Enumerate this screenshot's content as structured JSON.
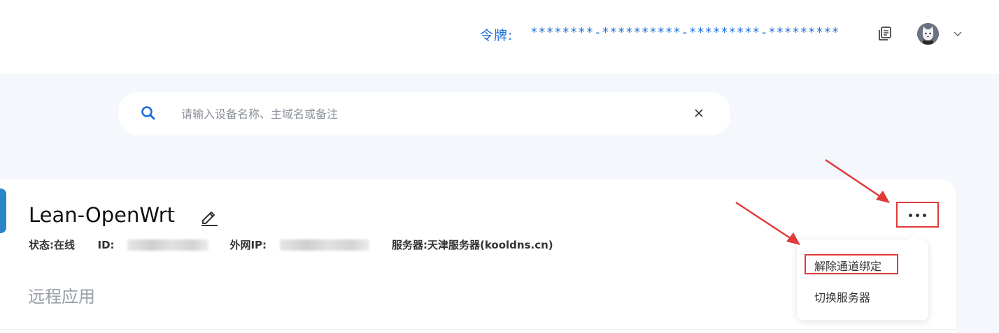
{
  "header": {
    "token_label": "令牌:",
    "token_value": "********-**********-*********-*********",
    "copy_icon": "copy-icon",
    "avatar_icon": "cat-avatar",
    "caret_icon": "chevron-down-icon"
  },
  "search": {
    "placeholder": "请输入设备名称、主域名或备注",
    "value": "",
    "search_icon": "search-icon",
    "clear_icon": "close-icon"
  },
  "device": {
    "name": "Lean-OpenWrt",
    "status_label": "状态:",
    "status_value": "在线",
    "id_label": "ID:",
    "ip_label": "外网IP:",
    "server_label": "服务器:",
    "server_value": "天津服务器(kooldns.cn)",
    "section_title": "远程应用"
  },
  "menu": {
    "items": [
      {
        "label": "解除通道绑定"
      },
      {
        "label": "切换服务器"
      }
    ]
  },
  "colors": {
    "accent": "#1a6fd8",
    "annotation": "#e03a3a",
    "background": "#f4f7fb"
  }
}
